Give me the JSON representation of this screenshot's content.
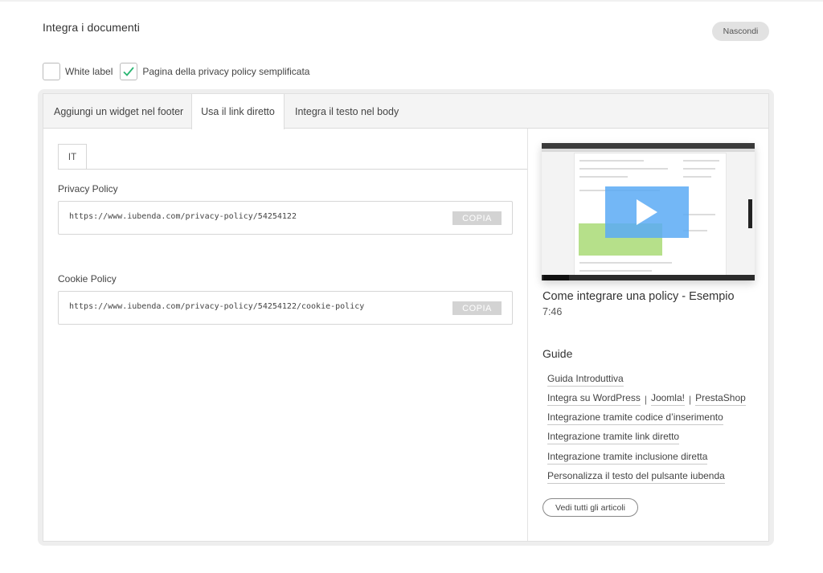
{
  "section": {
    "title": "Integra i documenti",
    "hide_label": "Nascondi"
  },
  "options": {
    "white_label": {
      "label": "White label",
      "checked": false
    },
    "privacy_simplified": {
      "label": "Pagina della privacy policy semplificata",
      "checked": true
    }
  },
  "tabs": [
    {
      "label": "Aggiungi un widget nel footer",
      "active": false
    },
    {
      "label": "Usa il link diretto",
      "active": true
    },
    {
      "label": "Integra il testo nel body",
      "active": false
    }
  ],
  "language_tab": "IT",
  "privacy": {
    "label": "Privacy Policy",
    "url": "https://www.iubenda.com/privacy-policy/54254122",
    "copy_label": "COPIA"
  },
  "cookie": {
    "label": "Cookie Policy",
    "url": "https://www.iubenda.com/privacy-policy/54254122/cookie-policy",
    "copy_label": "COPIA"
  },
  "video": {
    "title": "Come integrare una policy - Esempio",
    "duration": "7:46"
  },
  "guides": {
    "title": "Guide",
    "intro": "Guida Introduttiva",
    "integra_prefix": "Integra su WordPress",
    "joomla": "Joomla!",
    "prestashop": "PrestaShop",
    "codice": "Integrazione tramite codice d’inserimento",
    "link": "Integrazione tramite link diretto",
    "inclusione": "Integrazione tramite inclusione diretta",
    "pulsante": "Personalizza il testo del pulsante iubenda",
    "separator": "|",
    "all_label": "Vedi tutti gli articoli"
  },
  "colors": {
    "check_green": "#2bb673",
    "copy_bg": "#d3d3d3",
    "play_blue": "#5aaaf5"
  }
}
